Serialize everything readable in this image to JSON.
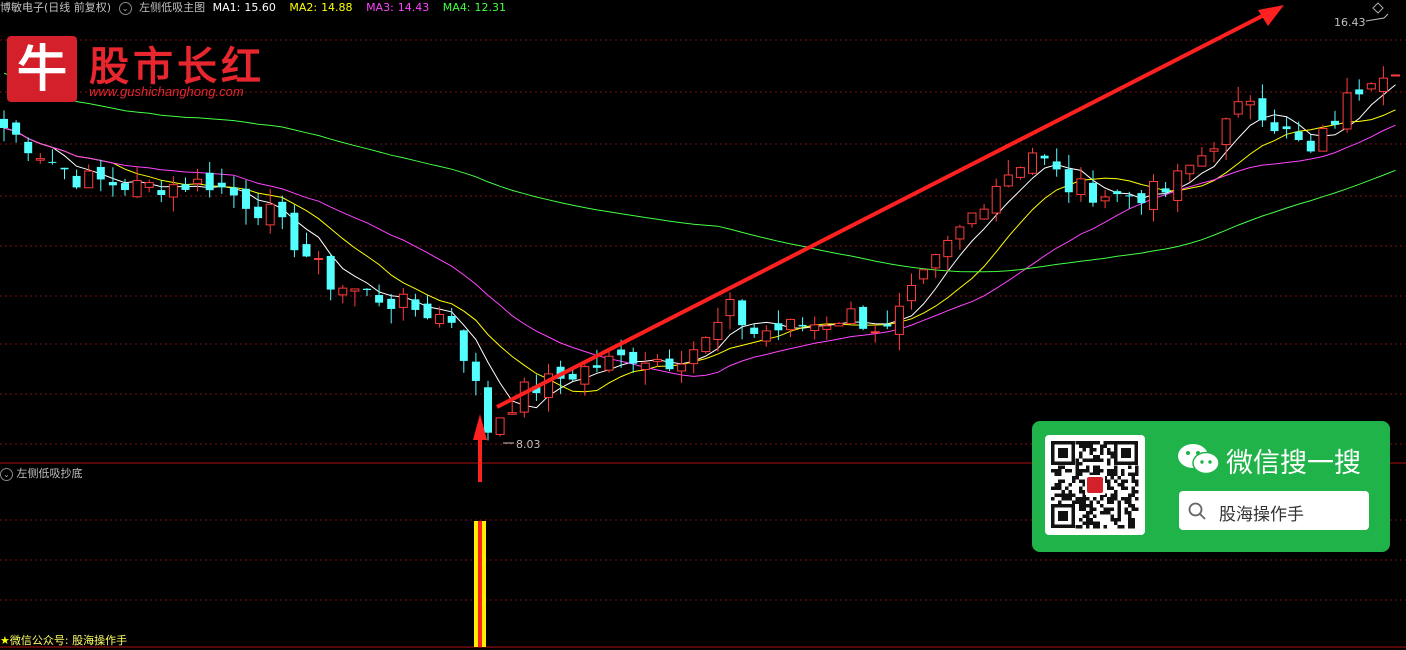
{
  "header": {
    "stock_name": "博敏电子(日线 前复权)",
    "indicator_name": "左侧低吸主图",
    "ma": [
      {
        "label": "MA1:",
        "value": "15.60",
        "color": "#ffffff"
      },
      {
        "label": "MA2:",
        "value": "14.88",
        "color": "#ffff00"
      },
      {
        "label": "MA3:",
        "value": "14.43",
        "color": "#ff44ff"
      },
      {
        "label": "MA4:",
        "value": "12.31",
        "color": "#44ff44"
      }
    ]
  },
  "logo": {
    "mark": "牛",
    "title": "股市长红",
    "url": "www.gushichanghong.com"
  },
  "chart_labels": {
    "low_label": "8.03",
    "high_label": "16.43"
  },
  "sub_indicator": {
    "name": "左侧低吸抄底"
  },
  "footer": {
    "star": "★",
    "text": "微信公众号: 股海操作手"
  },
  "wechat_card": {
    "title": "微信搜一搜",
    "search_text": "股海操作手"
  },
  "colors": {
    "up": "#ff3c3c",
    "down": "#54ffff",
    "ma1": "#ffffff",
    "ma2": "#ffff00",
    "ma3": "#ff44ff",
    "ma4": "#44ff44",
    "arrow": "#ff2020",
    "grid": "#7a1010"
  }
}
